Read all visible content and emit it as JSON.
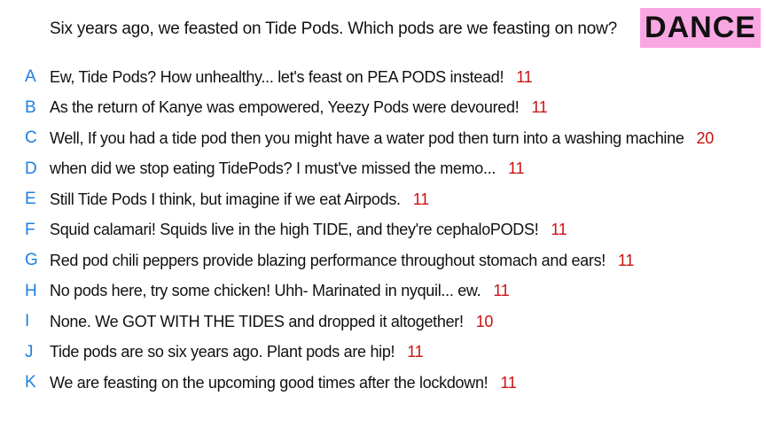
{
  "question": "Six years ago, we feasted on Tide Pods. Which pods are we feasting on now?",
  "badge": "DANCE",
  "colors": {
    "letter": "#1e7fe0",
    "score": "#cc1111",
    "badge_bg": "#f9a7e3",
    "text": "#111111"
  },
  "answers": [
    {
      "letter": "A",
      "text": "Ew, Tide Pods? How unhealthy... let's feast on PEA PODS instead!",
      "score": "11"
    },
    {
      "letter": "B",
      "text": "As the return of Kanye was empowered, Yeezy Pods were devoured!",
      "score": "11"
    },
    {
      "letter": "C",
      "text": "Well, If you had a tide pod then you might have a water pod then turn into a washing machine",
      "score": "20"
    },
    {
      "letter": "D",
      "text": "when did we stop eating TidePods? I must've missed the memo...",
      "score": "11"
    },
    {
      "letter": "E",
      "text": "Still Tide Pods I think, but imagine if we eat Airpods.",
      "score": "11"
    },
    {
      "letter": "F",
      "text": "Squid calamari! Squids live in the high TIDE, and they're cephaloPODS!",
      "score": "11"
    },
    {
      "letter": "G",
      "text": "Red pod chili peppers provide blazing performance throughout stomach and ears!",
      "score": "11"
    },
    {
      "letter": "H",
      "text": "No pods here, try some chicken! Uhh- Marinated in nyquil... ew.",
      "score": "11"
    },
    {
      "letter": "I",
      "text": "None. We GOT WITH THE TIDES and dropped it altogether!",
      "score": "10"
    },
    {
      "letter": "J",
      "text": "Tide pods are so six years ago. Plant pods are hip!",
      "score": "11"
    },
    {
      "letter": "K",
      "text": "We are feasting on the upcoming good times after the lockdown!",
      "score": "11"
    }
  ]
}
